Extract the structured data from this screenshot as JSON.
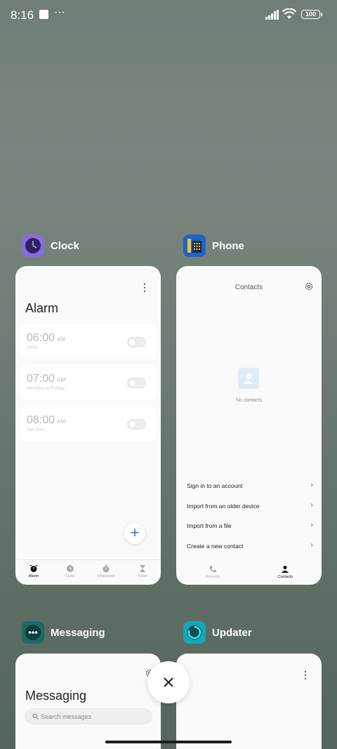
{
  "status_bar": {
    "time": "8:16",
    "dots": "···",
    "battery": "100"
  },
  "apps": {
    "clock": {
      "name": "Clock",
      "title": "Alarm",
      "more": "⋮",
      "alarms": [
        {
          "time": "06:00",
          "ampm": "AM",
          "repeat": "Daily",
          "enabled": false
        },
        {
          "time": "07:00",
          "ampm": "AM",
          "repeat": "Monday to Friday",
          "enabled": false
        },
        {
          "time": "08:00",
          "ampm": "AM",
          "repeat": "Sat Sun",
          "enabled": false
        }
      ],
      "fab": "+",
      "nav": [
        "Alarm",
        "Clock",
        "Stopwatch",
        "Timer"
      ]
    },
    "phone": {
      "name": "Phone",
      "title": "Contacts",
      "empty": "No contacts",
      "options": [
        "Sign in to an account",
        "Import from an older device",
        "Import from a file",
        "Create a new contact"
      ],
      "chevron": "›",
      "nav": [
        "Recents",
        "Contacts"
      ]
    },
    "messaging": {
      "name": "Messaging",
      "title": "Messaging",
      "search_placeholder": "Search messages"
    },
    "updater": {
      "name": "Updater",
      "more": "⋮"
    }
  },
  "colors": {
    "accent": "#2a7ed8",
    "clock_icon": "#8a6be0",
    "phone_icon": "#1f63c6",
    "messaging_icon": "#1b6b63",
    "updater_icon": "#17a5b8"
  }
}
